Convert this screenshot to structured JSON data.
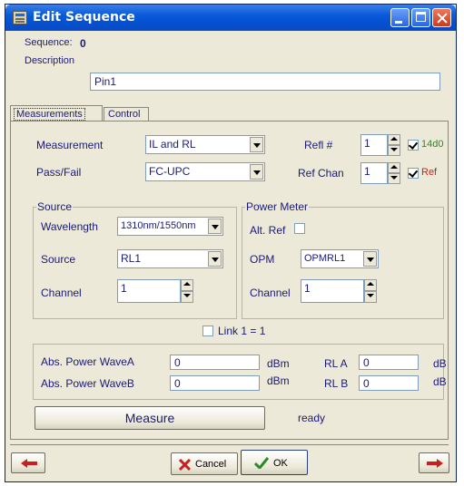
{
  "window": {
    "title": "Edit Sequence"
  },
  "header": {
    "sequence_label": "Sequence:",
    "sequence_value": "0",
    "description_label": "Description",
    "description_value": "Pin1"
  },
  "tabs": [
    {
      "label": "Measurements",
      "active": true
    },
    {
      "label": "Control",
      "active": false
    }
  ],
  "measurement": {
    "measurement_label": "Measurement",
    "measurement_value": "IL and RL",
    "passfail_label": "Pass/Fail",
    "passfail_value": "FC-UPC",
    "refl_label": "Refl #",
    "refl_value": "1",
    "refl_check_label": "14d0",
    "refl_check_checked": true,
    "refchan_label": "Ref Chan",
    "refchan_value": "1",
    "ref_check_label": "Ref",
    "ref_check_checked": true
  },
  "source": {
    "group_label": "Source",
    "wavelength_label": "Wavelength",
    "wavelength_value": "1310nm/1550nm",
    "source_label": "Source",
    "source_value": "RL1",
    "channel_label": "Channel",
    "channel_value": "1"
  },
  "power_meter": {
    "group_label": "Power Meter",
    "altref_label": "Alt. Ref",
    "altref_checked": false,
    "opm_label": "OPM",
    "opm_value": "OPMRL1",
    "channel_label": "Channel",
    "channel_value": "1"
  },
  "link": {
    "label": "Link 1 = 1",
    "checked": false
  },
  "results": {
    "abs_power_a_label": "Abs. Power WaveA",
    "abs_power_a_value": "0",
    "abs_power_a_unit": "dBm",
    "abs_power_b_label": "Abs. Power WaveB",
    "abs_power_b_value": "0",
    "abs_power_b_unit": "dBm",
    "rla_label": "RL A",
    "rla_value": "0",
    "rla_unit": "dB",
    "rlb_label": "RL B",
    "rlb_value": "0",
    "rlb_unit": "dB",
    "measure_button": "Measure",
    "status": "ready"
  },
  "footer": {
    "cancel_label": "Cancel",
    "ok_label": "OK"
  },
  "colors": {
    "accent_red": "#cc2020",
    "ok_green": "#2a8a2a",
    "text_navy": "#1a1a78"
  }
}
